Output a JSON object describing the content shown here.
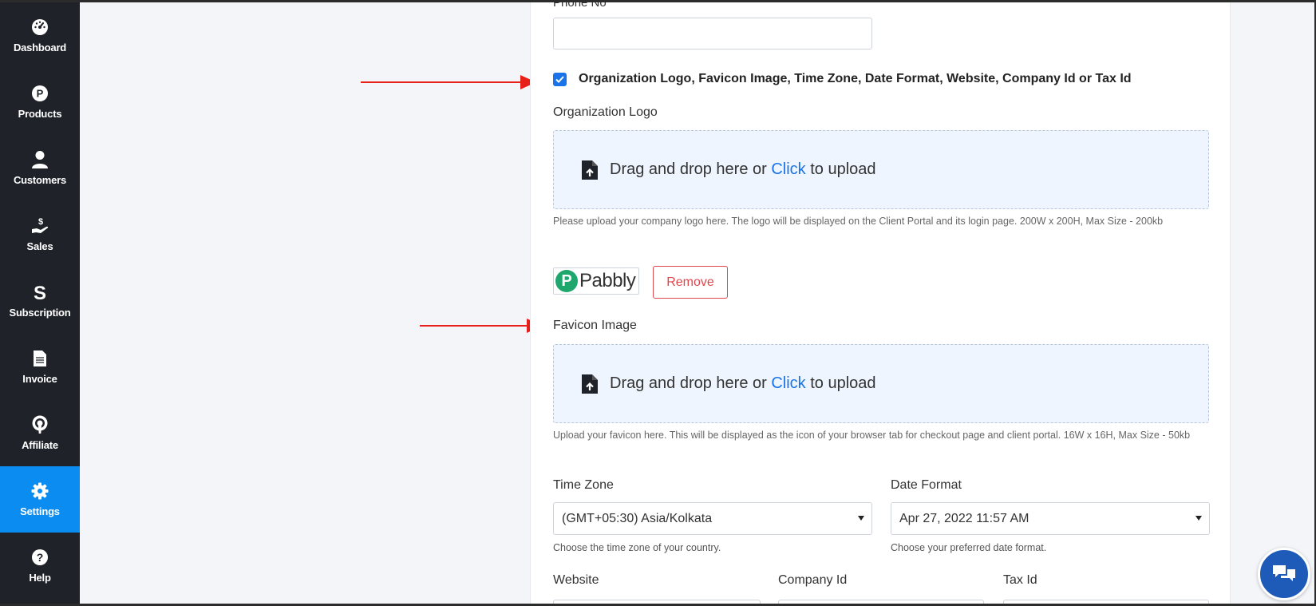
{
  "sidebar": {
    "items": [
      {
        "label": "Dashboard",
        "icon": "dashboard-icon"
      },
      {
        "label": "Products",
        "icon": "products-icon"
      },
      {
        "label": "Customers",
        "icon": "customers-icon"
      },
      {
        "label": "Sales",
        "icon": "sales-icon"
      },
      {
        "label": "Subscription",
        "icon": "subscription-icon"
      },
      {
        "label": "Invoice",
        "icon": "invoice-icon"
      },
      {
        "label": "Affiliate",
        "icon": "affiliate-icon"
      },
      {
        "label": "Settings",
        "icon": "gear-icon",
        "active": true
      },
      {
        "label": "Help",
        "icon": "help-icon"
      }
    ]
  },
  "form": {
    "phone": {
      "label": "Phone No",
      "value": ""
    },
    "toggle_extra": {
      "label": "Organization Logo, Favicon Image, Time Zone, Date Format, Website, Company Id or Tax Id",
      "checked": true
    },
    "org_logo": {
      "label": "Organization Logo",
      "dropzone": {
        "prefix": "Drag and drop here or ",
        "link": "Click",
        "suffix": " to upload"
      },
      "help": "Please upload your company logo here. The logo will be displayed on the Client Portal and its login page. 200W x 200H, Max Size - 200kb",
      "preview_letter": "P",
      "preview_text": "Pabbly",
      "remove_label": "Remove"
    },
    "favicon": {
      "label": "Favicon Image",
      "dropzone": {
        "prefix": "Drag and drop here or ",
        "link": "Click",
        "suffix": " to upload"
      },
      "help": "Upload your favicon here. This will be displayed as the icon of your browser tab for checkout page and client portal. 16W x 16H, Max Size - 50kb"
    },
    "time_zone": {
      "label": "Time Zone",
      "value": "(GMT+05:30) Asia/Kolkata",
      "help": "Choose the time zone of your country."
    },
    "date_format": {
      "label": "Date Format",
      "value": "Apr 27, 2022 11:57 AM",
      "help": "Choose your preferred date format."
    },
    "website": {
      "label": "Website"
    },
    "company_id": {
      "label": "Company Id"
    },
    "tax_id": {
      "label": "Tax Id"
    }
  },
  "colors": {
    "sidebar_bg": "#1f2329",
    "active": "#0b8cf0",
    "link": "#1a73e8",
    "danger": "#e0474c",
    "arrow": "#e8201a",
    "chat": "#1e5bb8"
  },
  "chat": {
    "icon": "chat-bubbles-icon"
  }
}
